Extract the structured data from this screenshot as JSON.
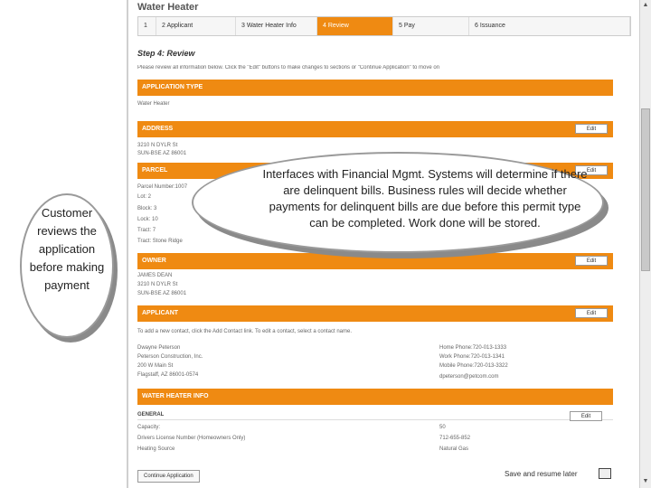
{
  "page_title": "Water Heater",
  "steps": [
    {
      "label": "1"
    },
    {
      "label": "2  Applicant"
    },
    {
      "label": "3  Water Heater Info"
    },
    {
      "label": "4  Review"
    },
    {
      "label": "5  Pay"
    },
    {
      "label": "6  Issuance"
    }
  ],
  "step_heading": "Step 4: Review",
  "intro": "Please review all information below. Click the \"Edit\" buttons to make changes to sections or \"Continue Application\" to move on",
  "edit_label": "Edit",
  "sections": {
    "application_type": {
      "title": "APPLICATION TYPE",
      "value": "Water Heater"
    },
    "address": {
      "title": "ADDRESS",
      "line1": "3210 N DYLR St",
      "line2": "SUN-BSE AZ 86001"
    },
    "parcel": {
      "title": "PARCEL",
      "lines": [
        "Parcel Number:1007",
        "Lot: 2",
        "Block: 3",
        "Lock: 10",
        "Tract: 7",
        "Tract: Stone Ridge"
      ]
    },
    "owner": {
      "title": "OWNER",
      "lines": [
        "JAMES DEAN",
        "3210 N DYLR St",
        "SUN-BSE AZ 86001"
      ]
    },
    "applicant": {
      "title": "APPLICANT",
      "instruction": "To add a new contact, click the Add Contact link. To edit a contact, select a contact name.",
      "left_lines": [
        "Dwayne Peterson",
        "Peterson Construction, Inc.",
        "200 W Main St",
        "Flagstaff, AZ 86001-0574"
      ],
      "right_lines": [
        "Home Phone:720-013-1333",
        "Work Phone:720-013-1341",
        "Mobile Phone:720-013-3322",
        "dpeterson@petcom.com"
      ]
    },
    "water_heater_info": {
      "title": "WATER HEATER INFO",
      "subheading": "GENERAL",
      "rows": [
        {
          "label": "Capacity:",
          "value": "50"
        },
        {
          "label": "Drivers License Number (Homeowners Only)",
          "value": "712-655-852"
        },
        {
          "label": "Heating Source",
          "value": "Natural Gas"
        }
      ]
    }
  },
  "continue_button": "Continue Application",
  "save_later": "Save and resume later",
  "callouts": {
    "left": "Customer reviews the application before making payment",
    "right": "Interfaces with Financial Mgmt. Systems will determine if there are delinquent bills.  Business rules will decide whether payments for delinquent bills are due before this permit type can be completed. Work done will be stored."
  },
  "colors": {
    "accent": "#ef8a12"
  }
}
